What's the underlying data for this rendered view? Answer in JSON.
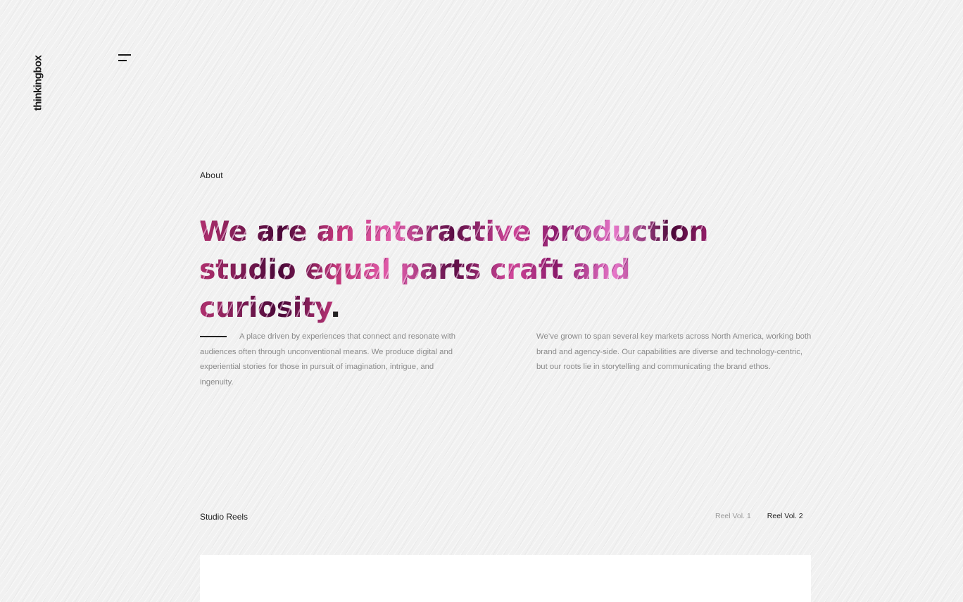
{
  "brand": {
    "logo_text": "thinkingbox"
  },
  "menu": {
    "icon": "hamburger-menu-icon"
  },
  "about": {
    "eyebrow": "About",
    "headline_main": "We are an interactive production studio equal parts craft and curiosity",
    "headline_period": ".",
    "paragraph_left": "A place driven by experiences that connect and resonate with audiences often through unconventional means. We produce digital and experiential stories for those in pursuit of imagination, intrigue, and ingenuity.",
    "paragraph_right": "We’ve grown to span several key markets across North America, working both brand and agency-side. Our capabilities are diverse and technology-centric, but our roots lie in storytelling and communicating the brand ethos."
  },
  "reels": {
    "title": "Studio Reels",
    "tabs": [
      {
        "label": "Reel Vol. 1",
        "active": false
      },
      {
        "label": "Reel Vol. 2",
        "active": true
      }
    ]
  },
  "colors": {
    "background": "#f1f1f1",
    "text": "#222222",
    "muted_text": "#8a8a8a",
    "headline_gradient": [
      "#b1306f",
      "#4a0838",
      "#e35fae",
      "#d1479a",
      "#e676c8"
    ]
  }
}
